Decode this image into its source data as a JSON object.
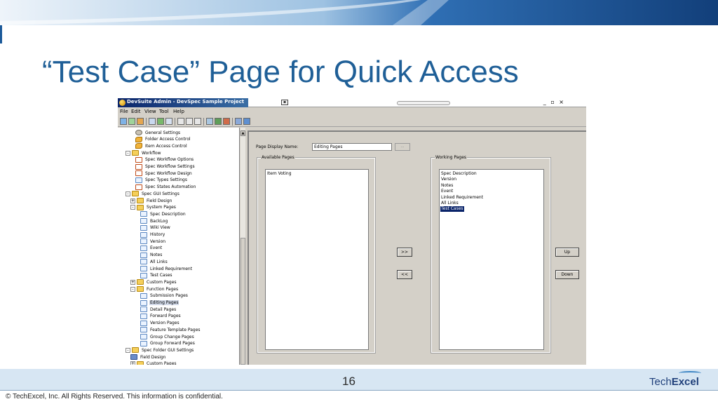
{
  "slide": {
    "title": "“Test Case” Page for Quick Access",
    "page_number": "16",
    "copyright": "© TechExcel, Inc. All Rights Reserved.  This information is confidential.",
    "brand_light": "Tech",
    "brand_bold": "Excel"
  },
  "window": {
    "title": "DevSuite Admin - DevSpec Sample Project",
    "controls": "_ ▫ ×",
    "menu": [
      "File",
      "Edit",
      "View",
      "Tool",
      "Help"
    ]
  },
  "tree": {
    "items": [
      {
        "label": "General Settings",
        "indent": 3,
        "icon": "gear-icon",
        "expander": ""
      },
      {
        "label": "Folder Access Control",
        "indent": 3,
        "icon": "key-icon",
        "expander": ""
      },
      {
        "label": "Item Access Control",
        "indent": 3,
        "icon": "key-icon",
        "expander": ""
      },
      {
        "label": "Workflow",
        "indent": 1,
        "icon": "folder-icon",
        "expander": "-"
      },
      {
        "label": "Spec Workflow Options",
        "indent": 3,
        "icon": "workflow-icon",
        "expander": ""
      },
      {
        "label": "Spec Workflow Settings",
        "indent": 3,
        "icon": "workflow-icon",
        "expander": ""
      },
      {
        "label": "Spec Workflow Design",
        "indent": 3,
        "icon": "workflow-icon",
        "expander": ""
      },
      {
        "label": "Spec Types Settings",
        "indent": 3,
        "icon": "page-icon",
        "expander": ""
      },
      {
        "label": "Spec States Automation",
        "indent": 3,
        "icon": "workflow-icon",
        "expander": ""
      },
      {
        "label": "Spec GUI Settings",
        "indent": 1,
        "icon": "folder-icon",
        "expander": "-"
      },
      {
        "label": "Field Design",
        "indent": 2,
        "icon": "folder-icon",
        "expander": "+"
      },
      {
        "label": "System Pages",
        "indent": 2,
        "icon": "folder-icon",
        "expander": "-"
      },
      {
        "label": "Spec Description",
        "indent": 4,
        "icon": "page-icon",
        "expander": ""
      },
      {
        "label": "BackLog",
        "indent": 4,
        "icon": "page-icon",
        "expander": ""
      },
      {
        "label": "Wiki View",
        "indent": 4,
        "icon": "page-icon",
        "expander": ""
      },
      {
        "label": "History",
        "indent": 4,
        "icon": "page-icon",
        "expander": ""
      },
      {
        "label": "Version",
        "indent": 4,
        "icon": "page-icon",
        "expander": ""
      },
      {
        "label": "Event",
        "indent": 4,
        "icon": "page-icon",
        "expander": ""
      },
      {
        "label": "Notes",
        "indent": 4,
        "icon": "page-icon",
        "expander": ""
      },
      {
        "label": "All Links",
        "indent": 4,
        "icon": "page-icon",
        "expander": ""
      },
      {
        "label": "Linked Requirement",
        "indent": 4,
        "icon": "page-icon",
        "expander": ""
      },
      {
        "label": "Test Cases",
        "indent": 4,
        "icon": "page-icon",
        "expander": ""
      },
      {
        "label": "Custom Pages",
        "indent": 2,
        "icon": "folder-icon",
        "expander": "+"
      },
      {
        "label": "Function Pages",
        "indent": 2,
        "icon": "folder-icon",
        "expander": "-"
      },
      {
        "label": "Submission Pages",
        "indent": 4,
        "icon": "page-icon",
        "expander": ""
      },
      {
        "label": "Editing Pages",
        "indent": 4,
        "icon": "page-icon",
        "expander": "",
        "selected": true
      },
      {
        "label": "Detail Pages",
        "indent": 4,
        "icon": "page-icon",
        "expander": ""
      },
      {
        "label": "Forward Pages",
        "indent": 4,
        "icon": "page-icon",
        "expander": ""
      },
      {
        "label": "Version Pages",
        "indent": 4,
        "icon": "page-icon",
        "expander": ""
      },
      {
        "label": "Feature Template Pages",
        "indent": 4,
        "icon": "page-icon",
        "expander": ""
      },
      {
        "label": "Group Change Pages",
        "indent": 4,
        "icon": "page-icon",
        "expander": ""
      },
      {
        "label": "Group Forward Pages",
        "indent": 4,
        "icon": "page-icon",
        "expander": ""
      },
      {
        "label": "Spec Folder GUI Settings",
        "indent": 1,
        "icon": "folder-icon",
        "expander": "-"
      },
      {
        "label": "Field Design",
        "indent": 2,
        "icon": "field-icon",
        "expander": ""
      },
      {
        "label": "Custom Pages",
        "indent": 2,
        "icon": "folder-icon",
        "expander": "+"
      }
    ]
  },
  "form": {
    "page_display_name_label": "Page Display Name:",
    "page_display_name_value": "Editing Pages",
    "name_button_label": "...",
    "available_title": "Available Pages",
    "available_items": [
      "Item Voting"
    ],
    "working_title": "Working Pages",
    "working_items": [
      "Spec Description",
      "Version",
      "Notes",
      "Event",
      "Linked Requirement",
      "All Links",
      "Test Cases"
    ],
    "working_selected": "Test Cases",
    "add_label": ">>",
    "remove_label": "<<",
    "up_label": "Up",
    "down_label": "Down"
  },
  "colors": {
    "title": "#1f5f97",
    "selection": "#0a246a",
    "footer_band": "#d7e6f3"
  }
}
